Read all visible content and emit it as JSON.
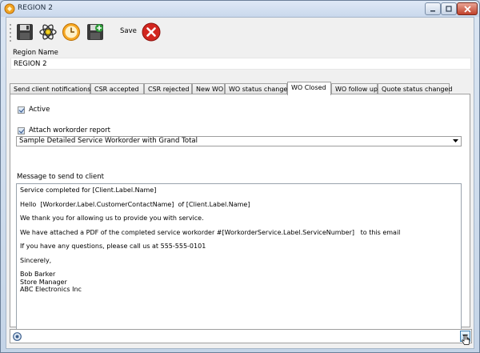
{
  "window": {
    "title": "REGION 2"
  },
  "toolbar": {
    "save_label": "Save"
  },
  "region_name": {
    "label": "Region Name",
    "value": "REGION 2"
  },
  "tabs": [
    {
      "label": "Send client notifications"
    },
    {
      "label": "CSR accepted"
    },
    {
      "label": "CSR rejected"
    },
    {
      "label": "New WO"
    },
    {
      "label": "WO status changed"
    },
    {
      "label": "WO Closed"
    },
    {
      "label": "WO follow up"
    },
    {
      "label": "Quote status changed"
    }
  ],
  "active_tab": "WO Closed",
  "wo_closed": {
    "active_label": "Active",
    "active_checked": true,
    "attach_label": "Attach workorder report",
    "attach_checked": true,
    "report_selected": "Sample Detailed Service Workorder with Grand Total",
    "message_label": "Message to send to client",
    "message_lines": [
      "Service completed for [Client.Label.Name]",
      "",
      "Hello  [Workorder.Label.CustomerContactName]  of [Client.Label.Name]",
      "",
      "We thank you for allowing us to provide you with service.",
      "",
      "We have attached a PDF of the completed service workorder #[WorkorderService.Label.ServiceNumber]   to this email",
      "",
      "If you have any questions, please call us at 555-555-0101",
      "",
      "Sincerely,",
      "",
      "Bob Barker",
      "Store Manager",
      "ABC Electronics Inc"
    ]
  },
  "footer": {
    "field_value": ""
  },
  "colors": {
    "title_bar": "#c9d8ec",
    "close_button": "#c0402a",
    "accent_blue": "#2d4f87"
  }
}
